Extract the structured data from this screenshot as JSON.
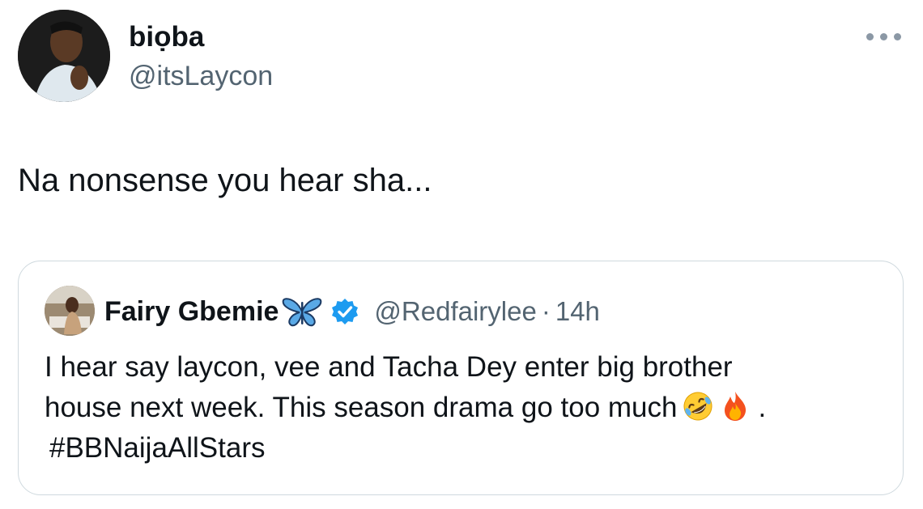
{
  "author": {
    "display_name": "biọba",
    "handle": "@itsLaycon"
  },
  "tweet": {
    "text": "Na nonsense you hear sha..."
  },
  "quoted": {
    "display_name": "Fairy Gbemie",
    "handle": "@Redfairylee",
    "separator": "·",
    "time": "14h",
    "text_line1": "I hear say laycon, vee and Tacha Dey enter big brother",
    "text_line2": "house next week. This season drama go too much",
    "text_tail": ".",
    "hashtag": "#BBNaijaAllStars"
  },
  "icons": {
    "more": "more-horizontal-icon",
    "verified": "verified-badge-icon",
    "butterfly": "butterfly-emoji",
    "laughing": "rolling-on-floor-laughing-emoji",
    "fire": "fire-emoji"
  },
  "colors": {
    "text": "#0f1419",
    "secondary": "#536471",
    "verified": "#1d9bf0",
    "border": "#cfd9de"
  }
}
